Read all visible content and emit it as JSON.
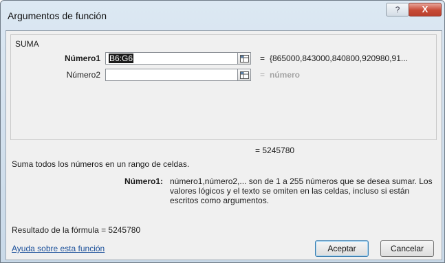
{
  "window": {
    "title": "Argumentos de función",
    "help_glyph": "?",
    "close_glyph": "X"
  },
  "function_group": {
    "name": "SUMA",
    "args": [
      {
        "label": "Número1",
        "value": "B6:G6",
        "result": "{865000,843000,840800,920980,91..."
      },
      {
        "label": "Número2",
        "value": "",
        "result": "número"
      }
    ],
    "equals": "="
  },
  "function_result": "= 5245780",
  "description": "Suma todos los números en un rango de celdas.",
  "arg_help": {
    "label": "Número1:",
    "text": "número1,número2,... son de 1 a 255 números que se desea sumar. Los valores lógicos y el texto se omiten en las celdas, incluso si están escritos como argumentos."
  },
  "formula_result": "Resultado de la fórmula =  5245780",
  "help_link": "Ayuda sobre esta función",
  "buttons": {
    "ok": "Aceptar",
    "cancel": "Cancelar"
  }
}
